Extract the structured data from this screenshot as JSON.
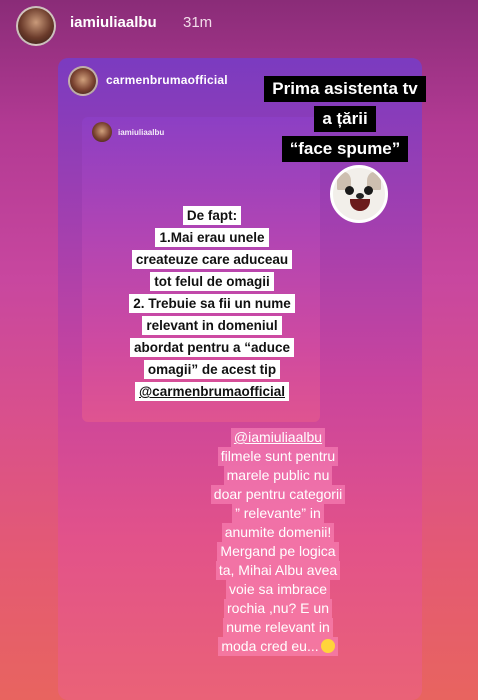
{
  "story": {
    "username": "iamiuliaalbu",
    "time": "31m"
  },
  "shared_story": {
    "username": "carmenbrumaofficial"
  },
  "inner_story": {
    "username": "iamiuliaalbu"
  },
  "caption_block": {
    "lines": [
      "Prima asistenta tv",
      "a țării",
      "“face spume”"
    ]
  },
  "reply_block": {
    "lines": [
      "De fapt:",
      "1.Mai erau unele",
      "createuze care aduceau",
      "tot felul de omagii",
      "2. Trebuie sa fii un nume",
      "relevant in domeniul",
      "abordat pentru a “aduce",
      "omagii” de acest tip",
      "@carmenbrumaofficial"
    ]
  },
  "response_block": {
    "lines": [
      "@iamiuliaalbu",
      "filmele sunt pentru",
      "marele public nu",
      "doar pentru categorii",
      "” relevante” in",
      "anumite domenii!",
      "Mergand pe logica",
      "ta, Mihai Albu avea",
      "voie sa imbrace",
      "rochia ,nu? E un",
      "nume relevant in",
      "moda cred eu..."
    ]
  },
  "icons": {
    "sticker": "laughing-dog-sticker",
    "emoji": "smiling-face-emoji"
  },
  "colors": {
    "bg_top": "#8a2c78",
    "bg_bottom": "#e8645f",
    "label_bg": "#000000",
    "text_box_bg": "#ffffff"
  }
}
